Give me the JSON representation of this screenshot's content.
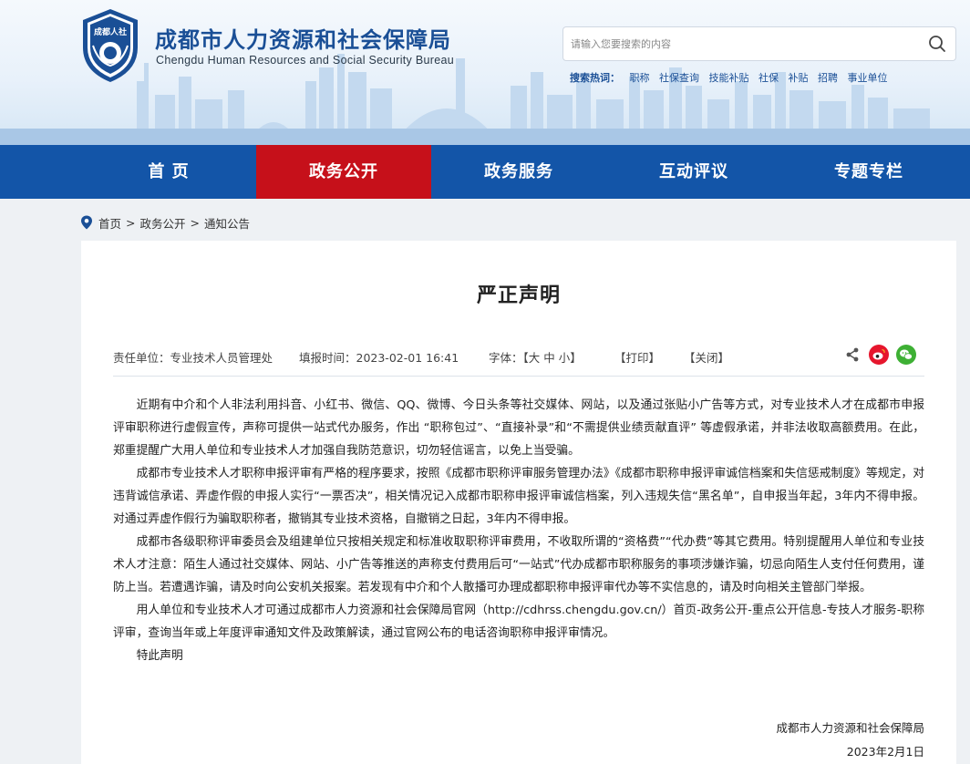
{
  "header": {
    "logo_text": "成都人社",
    "title": "成都市人力资源和社会保障局",
    "subtitle": "Chengdu Human Resources and Social Security Bureau",
    "search": {
      "placeholder": "请输入您要搜索的内容",
      "value": "",
      "icon": "search-icon"
    },
    "hot": {
      "label": "搜索热词：",
      "words": [
        "职称",
        "社保查询",
        "技能补贴",
        "社保",
        "补贴",
        "招聘",
        "事业单位"
      ]
    }
  },
  "nav": {
    "items": [
      {
        "label": "首 页",
        "active": false
      },
      {
        "label": "政务公开",
        "active": true
      },
      {
        "label": "政务服务",
        "active": false
      },
      {
        "label": "互动评议",
        "active": false
      },
      {
        "label": "专题专栏",
        "active": false
      }
    ]
  },
  "breadcrumb": {
    "icon": "location-pin-icon",
    "items": [
      "首页",
      "政务公开",
      "通知公告"
    ],
    "separator": ">"
  },
  "article": {
    "title": "严正声明",
    "meta": {
      "unit": "责任单位：专业技术人员管理处",
      "time": "填报时间：2023-02-01 16:41",
      "font_label": "字体：【",
      "font_large": "大",
      "font_medium": "中",
      "font_small": "小",
      "font_end": "】",
      "print": "【打印】",
      "close": "【关闭】",
      "share_icons": [
        "share-icon",
        "weibo-icon",
        "wechat-icon"
      ]
    },
    "paragraphs": [
      "近期有中介和个人非法利用抖音、小红书、微信、QQ、微博、今日头条等社交媒体、网站，以及通过张贴小广告等方式，对专业技术人才在成都市申报评审职称进行虚假宣传，声称可提供一站式代办服务，作出 “职称包过”、“直接补录”和“不需提供业绩贡献直评” 等虚假承诺，并非法收取高额费用。在此，郑重提醒广大用人单位和专业技术人才加强自我防范意识，切勿轻信谣言，以免上当受骗。",
      "成都市专业技术人才职称申报评审有严格的程序要求，按照《成都市职称评审服务管理办法》《成都市职称申报评审诚信档案和失信惩戒制度》等规定，对违背诚信承诺、弄虚作假的申报人实行“一票否决”，相关情况记入成都市职称申报评审诚信档案，列入违规失信“黑名单”，自申报当年起，3年内不得申报。对通过弄虚作假行为骗取职称者，撤销其专业技术资格，自撤销之日起，3年内不得申报。",
      "成都市各级职称评审委员会及组建单位只按相关规定和标准收取职称评审费用，不收取所谓的“资格费”“代办费”等其它费用。特别提醒用人单位和专业技术人才注意：陌生人通过社交媒体、网站、小广告等推送的声称支付费用后可“一站式”代办成都市职称服务的事项涉嫌诈骗，切忌向陌生人支付任何费用，谨防上当。若遭遇诈骗，请及时向公安机关报案。若发现有中介和个人散播可办理成都职称申报评审代办等不实信息的，请及时向相关主管部门举报。",
      "用人单位和专业技术人才可通过成都市人力资源和社会保障局官网（http://cdhrss.chengdu.gov.cn/）首页-政务公开-重点公开信息-专技人才服务-职称评审，查询当年或上年度评审通知文件及政策解读，通过官网公布的电话咨询职称申报评审情况。",
      "特此声明"
    ],
    "signature": "成都市人力资源和社会保障局",
    "date": "2023年2月1日"
  },
  "colors": {
    "nav_bg": "#1355a8",
    "nav_active": "#c6101a",
    "title_blue": "#1a4f96",
    "weibo_red": "#e6162d",
    "wechat_green": "#3eb034"
  }
}
